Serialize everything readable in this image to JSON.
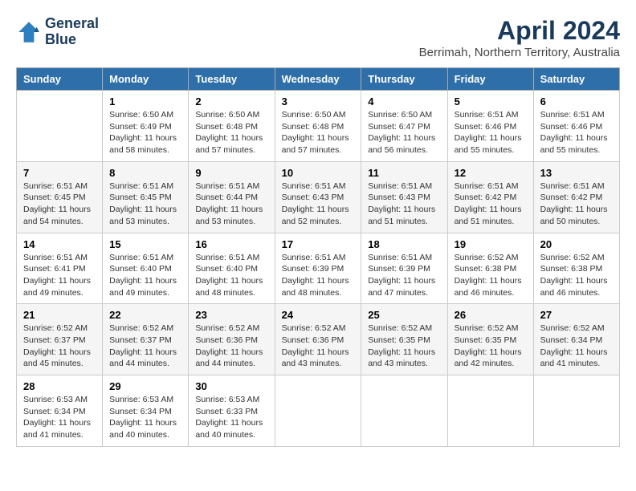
{
  "app": {
    "logo_line1": "General",
    "logo_line2": "Blue"
  },
  "title": {
    "month": "April 2024",
    "location": "Berrimah, Northern Territory, Australia"
  },
  "calendar": {
    "headers": [
      "Sunday",
      "Monday",
      "Tuesday",
      "Wednesday",
      "Thursday",
      "Friday",
      "Saturday"
    ],
    "rows": [
      [
        {
          "day": "",
          "info": ""
        },
        {
          "day": "1",
          "info": "Sunrise: 6:50 AM\nSunset: 6:49 PM\nDaylight: 11 hours\nand 58 minutes."
        },
        {
          "day": "2",
          "info": "Sunrise: 6:50 AM\nSunset: 6:48 PM\nDaylight: 11 hours\nand 57 minutes."
        },
        {
          "day": "3",
          "info": "Sunrise: 6:50 AM\nSunset: 6:48 PM\nDaylight: 11 hours\nand 57 minutes."
        },
        {
          "day": "4",
          "info": "Sunrise: 6:50 AM\nSunset: 6:47 PM\nDaylight: 11 hours\nand 56 minutes."
        },
        {
          "day": "5",
          "info": "Sunrise: 6:51 AM\nSunset: 6:46 PM\nDaylight: 11 hours\nand 55 minutes."
        },
        {
          "day": "6",
          "info": "Sunrise: 6:51 AM\nSunset: 6:46 PM\nDaylight: 11 hours\nand 55 minutes."
        }
      ],
      [
        {
          "day": "7",
          "info": "Sunrise: 6:51 AM\nSunset: 6:45 PM\nDaylight: 11 hours\nand 54 minutes."
        },
        {
          "day": "8",
          "info": "Sunrise: 6:51 AM\nSunset: 6:45 PM\nDaylight: 11 hours\nand 53 minutes."
        },
        {
          "day": "9",
          "info": "Sunrise: 6:51 AM\nSunset: 6:44 PM\nDaylight: 11 hours\nand 53 minutes."
        },
        {
          "day": "10",
          "info": "Sunrise: 6:51 AM\nSunset: 6:43 PM\nDaylight: 11 hours\nand 52 minutes."
        },
        {
          "day": "11",
          "info": "Sunrise: 6:51 AM\nSunset: 6:43 PM\nDaylight: 11 hours\nand 51 minutes."
        },
        {
          "day": "12",
          "info": "Sunrise: 6:51 AM\nSunset: 6:42 PM\nDaylight: 11 hours\nand 51 minutes."
        },
        {
          "day": "13",
          "info": "Sunrise: 6:51 AM\nSunset: 6:42 PM\nDaylight: 11 hours\nand 50 minutes."
        }
      ],
      [
        {
          "day": "14",
          "info": "Sunrise: 6:51 AM\nSunset: 6:41 PM\nDaylight: 11 hours\nand 49 minutes."
        },
        {
          "day": "15",
          "info": "Sunrise: 6:51 AM\nSunset: 6:40 PM\nDaylight: 11 hours\nand 49 minutes."
        },
        {
          "day": "16",
          "info": "Sunrise: 6:51 AM\nSunset: 6:40 PM\nDaylight: 11 hours\nand 48 minutes."
        },
        {
          "day": "17",
          "info": "Sunrise: 6:51 AM\nSunset: 6:39 PM\nDaylight: 11 hours\nand 48 minutes."
        },
        {
          "day": "18",
          "info": "Sunrise: 6:51 AM\nSunset: 6:39 PM\nDaylight: 11 hours\nand 47 minutes."
        },
        {
          "day": "19",
          "info": "Sunrise: 6:52 AM\nSunset: 6:38 PM\nDaylight: 11 hours\nand 46 minutes."
        },
        {
          "day": "20",
          "info": "Sunrise: 6:52 AM\nSunset: 6:38 PM\nDaylight: 11 hours\nand 46 minutes."
        }
      ],
      [
        {
          "day": "21",
          "info": "Sunrise: 6:52 AM\nSunset: 6:37 PM\nDaylight: 11 hours\nand 45 minutes."
        },
        {
          "day": "22",
          "info": "Sunrise: 6:52 AM\nSunset: 6:37 PM\nDaylight: 11 hours\nand 44 minutes."
        },
        {
          "day": "23",
          "info": "Sunrise: 6:52 AM\nSunset: 6:36 PM\nDaylight: 11 hours\nand 44 minutes."
        },
        {
          "day": "24",
          "info": "Sunrise: 6:52 AM\nSunset: 6:36 PM\nDaylight: 11 hours\nand 43 minutes."
        },
        {
          "day": "25",
          "info": "Sunrise: 6:52 AM\nSunset: 6:35 PM\nDaylight: 11 hours\nand 43 minutes."
        },
        {
          "day": "26",
          "info": "Sunrise: 6:52 AM\nSunset: 6:35 PM\nDaylight: 11 hours\nand 42 minutes."
        },
        {
          "day": "27",
          "info": "Sunrise: 6:52 AM\nSunset: 6:34 PM\nDaylight: 11 hours\nand 41 minutes."
        }
      ],
      [
        {
          "day": "28",
          "info": "Sunrise: 6:53 AM\nSunset: 6:34 PM\nDaylight: 11 hours\nand 41 minutes."
        },
        {
          "day": "29",
          "info": "Sunrise: 6:53 AM\nSunset: 6:34 PM\nDaylight: 11 hours\nand 40 minutes."
        },
        {
          "day": "30",
          "info": "Sunrise: 6:53 AM\nSunset: 6:33 PM\nDaylight: 11 hours\nand 40 minutes."
        },
        {
          "day": "",
          "info": ""
        },
        {
          "day": "",
          "info": ""
        },
        {
          "day": "",
          "info": ""
        },
        {
          "day": "",
          "info": ""
        }
      ]
    ]
  }
}
